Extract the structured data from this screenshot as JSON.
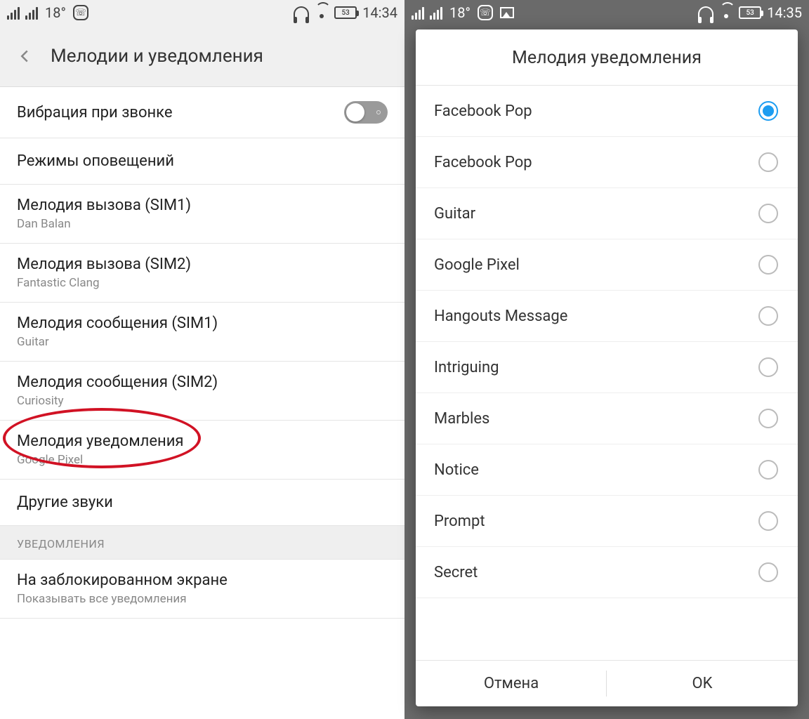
{
  "left": {
    "status": {
      "temp": "18°",
      "battery": "53",
      "time": "14:34"
    },
    "appbar_title": "Мелодии и уведомления",
    "items": [
      {
        "title": "Вибрация при звонке",
        "type": "toggle"
      },
      {
        "title": "Режимы оповещений",
        "type": "plain"
      },
      {
        "title": "Мелодия вызова (SIM1)",
        "sub": "Dan Balan",
        "type": "sub"
      },
      {
        "title": "Мелодия вызова (SIM2)",
        "sub": "Fantastic Clang",
        "type": "sub"
      },
      {
        "title": "Мелодия сообщения (SIM1)",
        "sub": "Guitar",
        "type": "sub"
      },
      {
        "title": "Мелодия сообщения (SIM2)",
        "sub": "Curiosity",
        "type": "sub"
      },
      {
        "title": "Мелодия уведомления",
        "sub": "Google Pixel",
        "type": "sub",
        "highlighted": true
      },
      {
        "title": "Другие звуки",
        "type": "plain"
      }
    ],
    "section_header": "УВЕДОМЛЕНИЯ",
    "last_item": {
      "title": "На заблокированном экране",
      "sub": "Показывать все уведомления"
    }
  },
  "right": {
    "status": {
      "temp": "18°",
      "battery": "53",
      "time": "14:35"
    },
    "dialog_title": "Мелодия уведомления",
    "options": [
      {
        "label": "Facebook Pop",
        "selected": true
      },
      {
        "label": "Facebook Pop",
        "selected": false
      },
      {
        "label": "Guitar",
        "selected": false
      },
      {
        "label": "Google Pixel",
        "selected": false
      },
      {
        "label": "Hangouts Message",
        "selected": false
      },
      {
        "label": "Intriguing",
        "selected": false
      },
      {
        "label": "Marbles",
        "selected": false
      },
      {
        "label": "Notice",
        "selected": false
      },
      {
        "label": "Prompt",
        "selected": false
      },
      {
        "label": "Secret",
        "selected": false
      }
    ],
    "cancel_label": "Отмена",
    "ok_label": "OK"
  }
}
